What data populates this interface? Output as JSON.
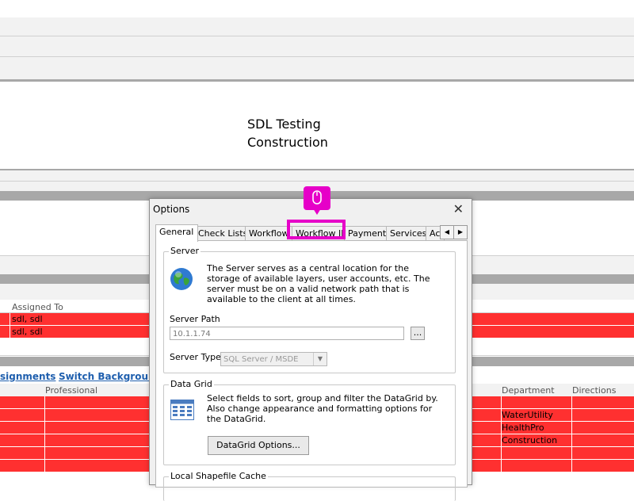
{
  "page": {
    "title_line1": "SDL Testing",
    "title_line2": "Construction"
  },
  "assigned_table": {
    "header": "Assigned To",
    "rows": [
      "sdl, sdl",
      "sdl, sdl"
    ]
  },
  "links": {
    "assignments": "signments",
    "switch_background": "Switch Background"
  },
  "main_table": {
    "headers": {
      "professional": "Professional",
      "department": "Department",
      "directions": "Directions"
    },
    "departments": [
      "WaterUtility",
      "HealthPro",
      "Construction"
    ]
  },
  "dialog": {
    "title": "Options",
    "close_glyph": "✕",
    "tabs": [
      {
        "label": "General"
      },
      {
        "label": "Check Lists"
      },
      {
        "label": "Workflow"
      },
      {
        "label": "Workflow II"
      },
      {
        "label": "Payment"
      },
      {
        "label": "Services"
      },
      {
        "label": "Ac"
      }
    ],
    "active_tab": "General",
    "server": {
      "group_title": "Server",
      "description": "The Server serves as a central location for the storage of available layers, user accounts, etc. The server must be on a valid network path that is available to the client at all times.",
      "path_label": "Server Path",
      "path_value": "10.1.1.74",
      "browse_label": "...",
      "type_label": "Server Type",
      "type_value": "SQL Server / MSDE"
    },
    "datagrid": {
      "group_title": "Data Grid",
      "description": "Select fields to sort, group and filter the DataGrid by. Also change appearance and formatting options for the DataGrid.",
      "options_button": "DataGrid Options..."
    },
    "next_group_title": "Local Shapefile Cache"
  },
  "icons": {
    "globe": "globe-icon",
    "grid": "datagrid-icon",
    "mouse": "mouse-icon"
  },
  "colors": {
    "highlight": "#e600c8",
    "row_red": "#ff3030",
    "link_blue": "#1f5fae"
  }
}
